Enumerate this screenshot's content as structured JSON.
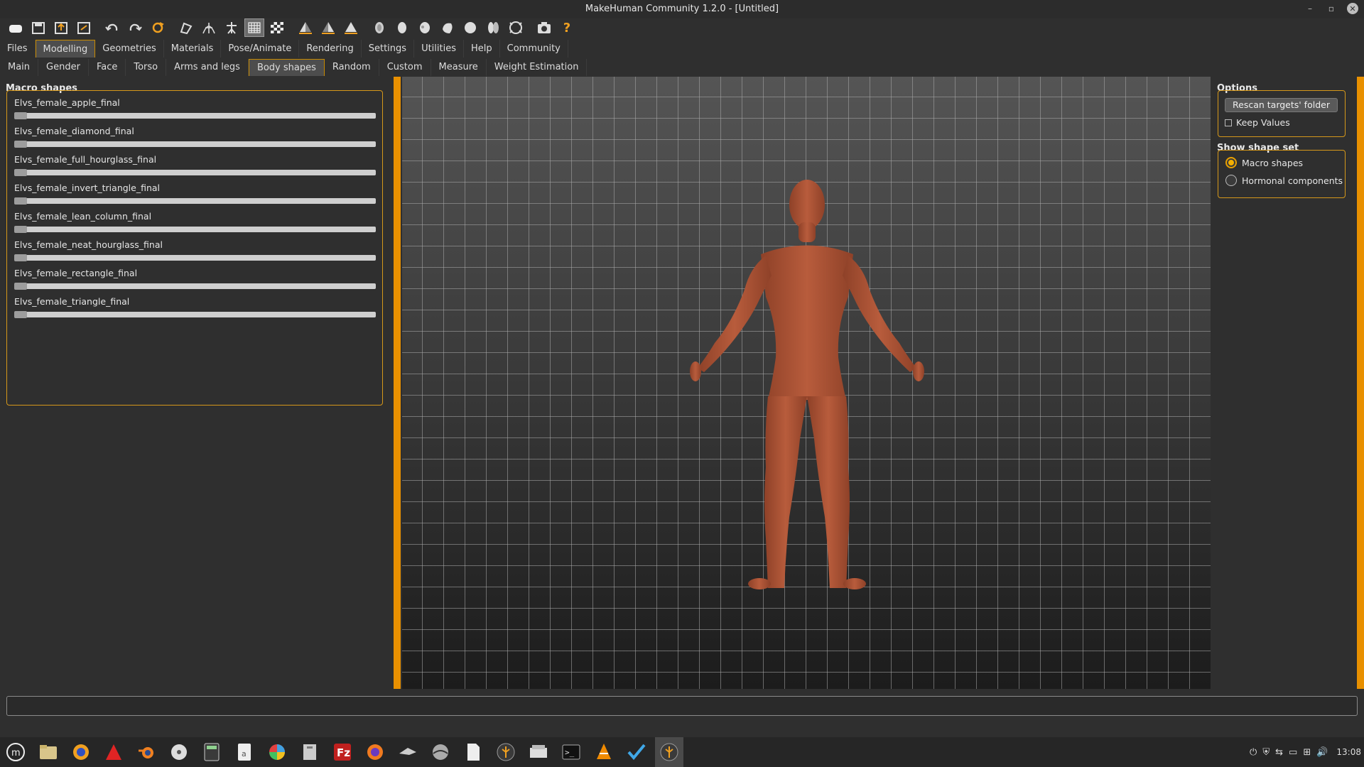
{
  "window": {
    "title": "MakeHuman Community 1.2.0 - [Untitled]"
  },
  "menu_tabs": [
    {
      "label": "Files"
    },
    {
      "label": "Modelling",
      "active": true
    },
    {
      "label": "Geometries"
    },
    {
      "label": "Materials"
    },
    {
      "label": "Pose/Animate"
    },
    {
      "label": "Rendering"
    },
    {
      "label": "Settings"
    },
    {
      "label": "Utilities"
    },
    {
      "label": "Help"
    },
    {
      "label": "Community"
    }
  ],
  "sub_tabs": [
    {
      "label": "Main"
    },
    {
      "label": "Gender"
    },
    {
      "label": "Face"
    },
    {
      "label": "Torso"
    },
    {
      "label": "Arms and legs"
    },
    {
      "label": "Body shapes",
      "active": true
    },
    {
      "label": "Random"
    },
    {
      "label": "Custom"
    },
    {
      "label": "Measure"
    },
    {
      "label": "Weight Estimation"
    }
  ],
  "left_panel": {
    "group_title": "Macro shapes",
    "sliders": [
      {
        "label": "Elvs_female_apple_final",
        "value": 0
      },
      {
        "label": "Elvs_female_diamond_final",
        "value": 0
      },
      {
        "label": "Elvs_female_full_hourglass_final",
        "value": 0
      },
      {
        "label": "Elvs_female_invert_triangle_final",
        "value": 0
      },
      {
        "label": "Elvs_female_lean_column_final",
        "value": 0
      },
      {
        "label": "Elvs_female_neat_hourglass_final",
        "value": 0
      },
      {
        "label": "Elvs_female_rectangle_final",
        "value": 0
      },
      {
        "label": "Elvs_female_triangle_final",
        "value": 0
      }
    ]
  },
  "right_panel": {
    "options_title": "Options",
    "rescan_label": "Rescan targets' folder",
    "keep_values_label": "Keep Values",
    "keep_values_checked": false,
    "shape_set_title": "Show shape set",
    "shape_sets": [
      {
        "label": "Macro shapes",
        "selected": true
      },
      {
        "label": "Hormonal components",
        "selected": false
      }
    ]
  },
  "taskbar": {
    "apps": [
      "mint-menu-icon",
      "files-icon",
      "app-icon",
      "app-icon",
      "blender-icon",
      "disc-icon",
      "calculator-icon",
      "text-editor-icon",
      "darktable-icon",
      "archive-icon",
      "filezilla-icon",
      "firefox-icon",
      "app-icon",
      "app-icon",
      "document-icon",
      "makehuman-icon",
      "scanner-icon",
      "terminal-icon",
      "vlc-icon",
      "app-icon",
      "makehuman-icon"
    ],
    "active_index": 20,
    "clock": "13:08"
  },
  "colors": {
    "accent": "#e89000",
    "skin": "#b0573a"
  }
}
